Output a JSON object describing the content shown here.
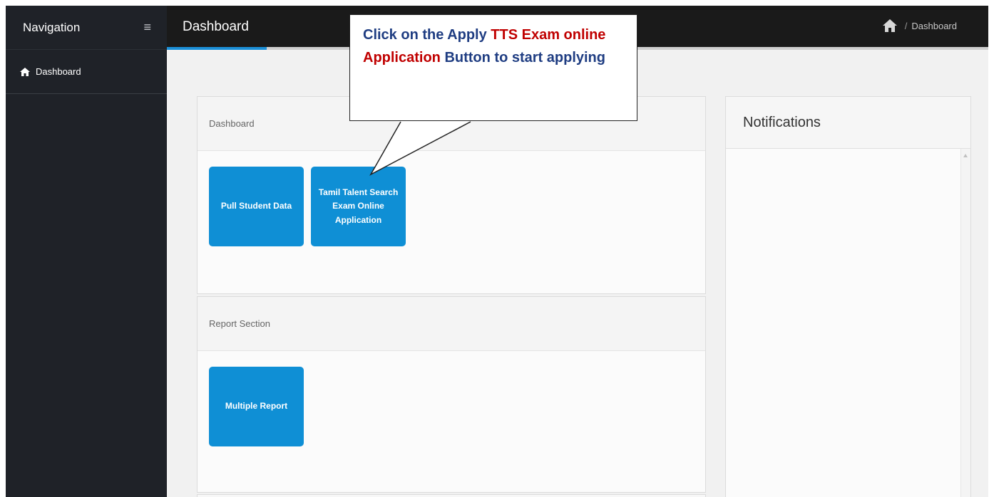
{
  "sidebar": {
    "title": "Navigation",
    "menu_icon": "hamburger-icon",
    "items": [
      {
        "label": "Dashboard",
        "icon": "home-icon"
      }
    ]
  },
  "header": {
    "title": "Dashboard",
    "breadcrumb": {
      "icon": "home-icon",
      "separator": "/",
      "current": "Dashboard"
    }
  },
  "panels": {
    "dashboard": {
      "title": "Dashboard",
      "tiles": [
        {
          "label": "Pull Student Data"
        },
        {
          "label_line1": "Tamil Talent Search",
          "label_line2": "Exam Online Application"
        }
      ]
    },
    "report": {
      "title": "Report Section",
      "tiles": [
        {
          "label": "Multiple Report"
        }
      ]
    }
  },
  "notifications": {
    "title": "Notifications"
  },
  "callout": {
    "part1": "Click on the Apply ",
    "part2": "TTS Exam online Application",
    "part3": " Button to start applying"
  },
  "colors": {
    "accent": "#1b8fd7",
    "tile": "#0f8fd5",
    "sidebar": "#1f2228",
    "topbar": "#1a1a1a",
    "callout_text": "#1f3d82",
    "callout_highlight": "#c00000"
  }
}
